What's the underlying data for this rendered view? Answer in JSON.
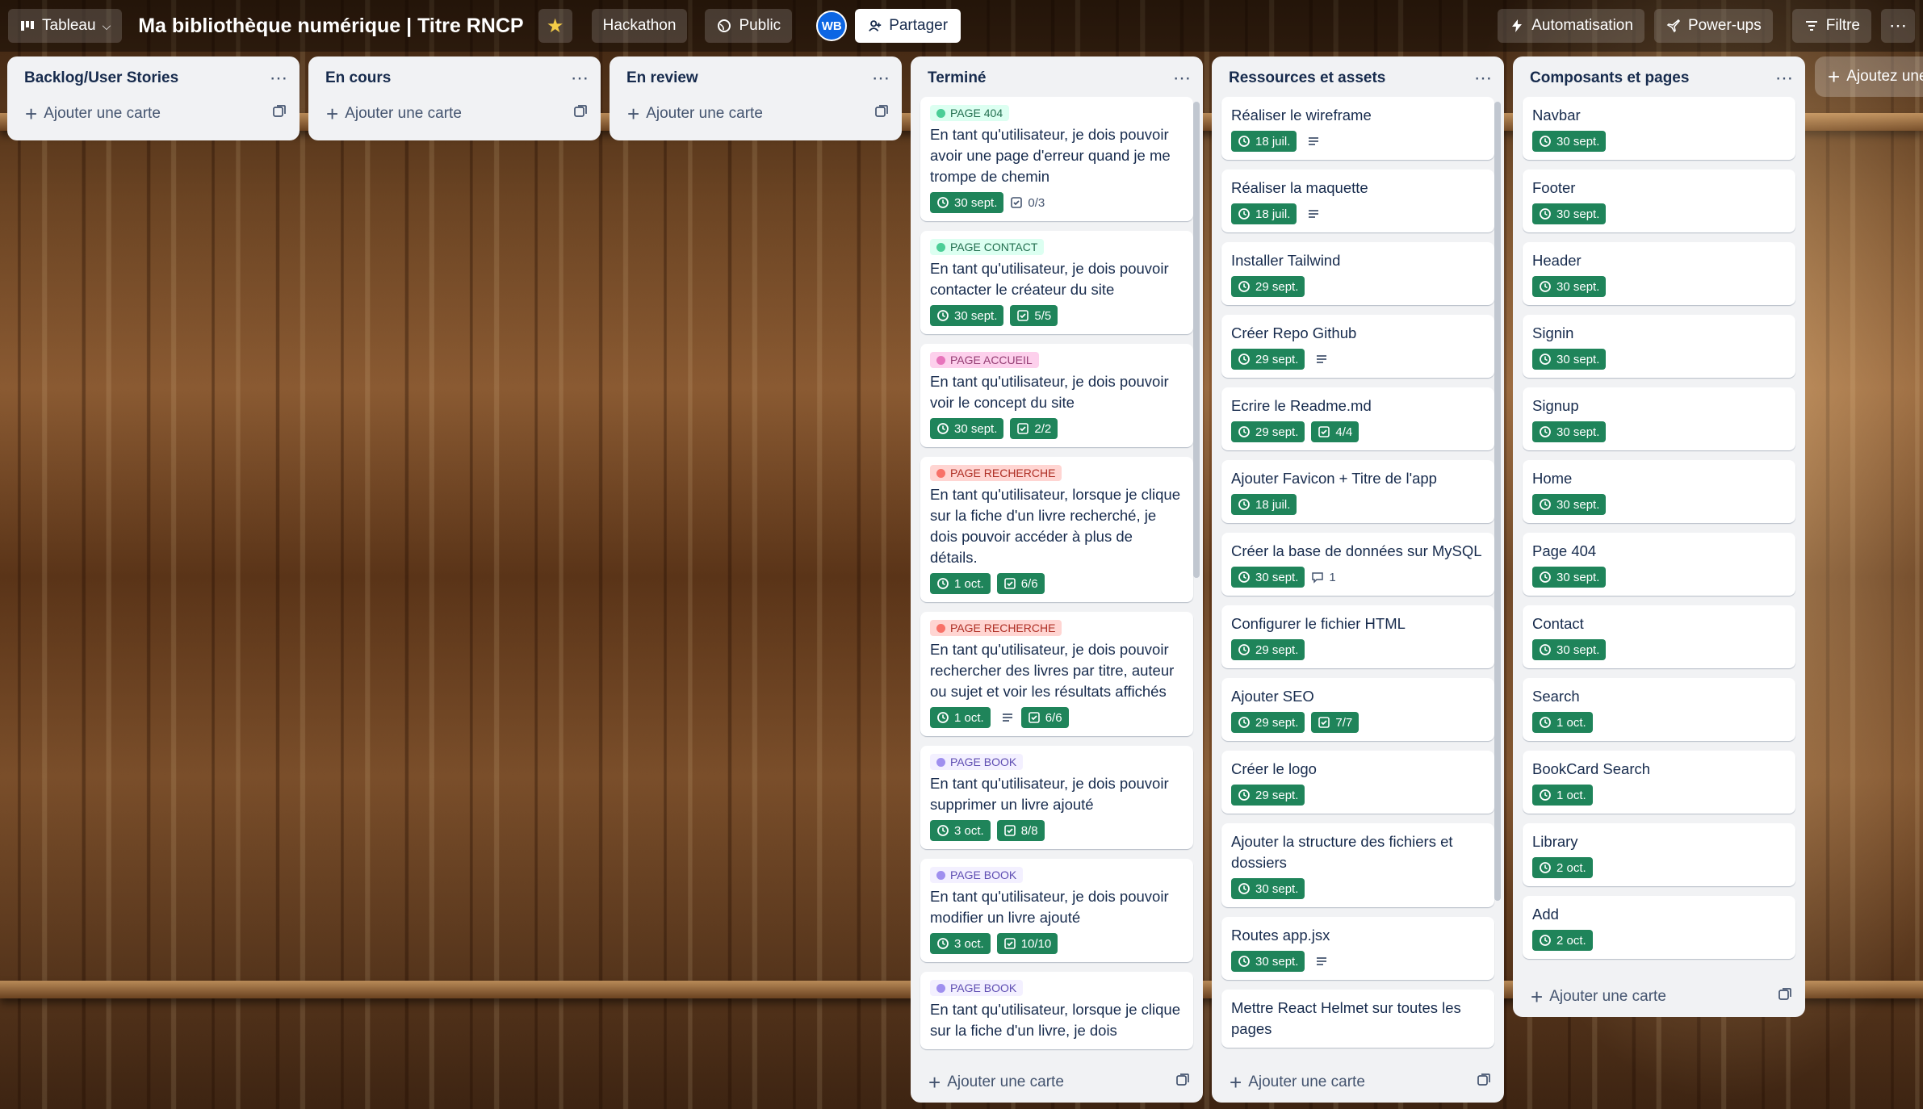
{
  "topbar": {
    "view_label": "Tableau",
    "board_title": "Ma bibliothèque numérique | Titre RNCP",
    "workspace": "Hackathon",
    "visibility": "Public",
    "avatar": "WB",
    "share": "Partager",
    "automation": "Automatisation",
    "powerups": "Power-ups",
    "filter": "Filtre"
  },
  "add_card": "Ajouter une carte",
  "add_list": "Ajoutez une liste",
  "colors": {
    "badge_green": "#1f845a",
    "label_green": "#dcfff1",
    "label_pink": "#fdd0ec",
    "label_red": "#ffd5d2",
    "label_purple": "#f3f0ff"
  },
  "lists": [
    {
      "title": "Backlog/User Stories",
      "cards": []
    },
    {
      "title": "En cours",
      "cards": []
    },
    {
      "title": "En review",
      "cards": []
    },
    {
      "title": "Terminé",
      "cards": [
        {
          "label": "PAGE 404",
          "label_color": "green",
          "title": "En tant qu'utilisateur, je dois pouvoir avoir une page d'erreur quand je me trompe de chemin",
          "due": "30 sept.",
          "checklist": "0/3",
          "checklist_done": false
        },
        {
          "label": "PAGE CONTACT",
          "label_color": "green",
          "title": "En tant qu'utilisateur, je dois pouvoir contacter le créateur du site",
          "due": "30 sept.",
          "checklist": "5/5",
          "checklist_done": true
        },
        {
          "label": "PAGE ACCUEIL",
          "label_color": "pink",
          "title": "En tant qu'utilisateur, je dois pouvoir voir le concept du site",
          "due": "30 sept.",
          "checklist": "2/2",
          "checklist_done": true
        },
        {
          "label": "PAGE RECHERCHE",
          "label_color": "red",
          "title": "En tant qu'utilisateur, lorsque je clique sur la fiche d'un livre recherché, je dois pouvoir accéder à plus de détails.",
          "due": "1 oct.",
          "checklist": "6/6",
          "checklist_done": true
        },
        {
          "label": "PAGE RECHERCHE",
          "label_color": "red",
          "title": "En tant qu'utilisateur, je dois pouvoir rechercher des livres par titre, auteur ou sujet et voir les résultats affichés",
          "due": "1 oct.",
          "description": true,
          "checklist": "6/6",
          "checklist_done": true
        },
        {
          "label": "PAGE BOOK",
          "label_color": "purple",
          "title": "En tant qu'utilisateur, je dois pouvoir supprimer un livre ajouté",
          "due": "3 oct.",
          "checklist": "8/8",
          "checklist_done": true
        },
        {
          "label": "PAGE BOOK",
          "label_color": "purple",
          "title": "En tant qu'utilisateur, je dois pouvoir modifier un livre ajouté",
          "due": "3 oct.",
          "checklist": "10/10",
          "checklist_done": true
        },
        {
          "label": "PAGE BOOK",
          "label_color": "purple",
          "title": "En tant qu'utilisateur, lorsque je clique sur la fiche d'un livre, je dois"
        }
      ]
    },
    {
      "title": "Ressources et assets",
      "cards": [
        {
          "title": "Réaliser le wireframe",
          "due": "18 juil.",
          "description": true
        },
        {
          "title": "Réaliser la maquette",
          "due": "18 juil.",
          "description": true
        },
        {
          "title": "Installer Tailwind",
          "due": "29 sept."
        },
        {
          "title": "Créer Repo Github",
          "due": "29 sept.",
          "description": true
        },
        {
          "title": "Ecrire le Readme.md",
          "due": "29 sept.",
          "checklist": "4/4",
          "checklist_done": true
        },
        {
          "title": "Ajouter Favicon + Titre de l'app",
          "due": "18 juil."
        },
        {
          "title": "Créer la base de données sur MySQL",
          "due": "30 sept.",
          "comments": "1"
        },
        {
          "title": "Configurer le fichier HTML",
          "due": "29 sept."
        },
        {
          "title": "Ajouter SEO",
          "due": "29 sept.",
          "checklist": "7/7",
          "checklist_done": true
        },
        {
          "title": "Créer le logo",
          "due": "29 sept."
        },
        {
          "title": "Ajouter la structure des fichiers et dossiers",
          "due": "30 sept."
        },
        {
          "title": "Routes app.jsx",
          "due": "30 sept.",
          "description": true
        },
        {
          "title": "Mettre React Helmet sur toutes les pages",
          "due": ""
        }
      ]
    },
    {
      "title": "Composants et pages",
      "cards": [
        {
          "title": "Navbar",
          "due": "30 sept."
        },
        {
          "title": "Footer",
          "due": "30 sept."
        },
        {
          "title": "Header",
          "due": "30 sept."
        },
        {
          "title": "Signin",
          "due": "30 sept."
        },
        {
          "title": "Signup",
          "due": "30 sept."
        },
        {
          "title": "Home",
          "due": "30 sept."
        },
        {
          "title": "Page 404",
          "due": "30 sept."
        },
        {
          "title": "Contact",
          "due": "30 sept."
        },
        {
          "title": "Search",
          "due": "1 oct."
        },
        {
          "title": "BookCard Search",
          "due": "1 oct."
        },
        {
          "title": "Library",
          "due": "2 oct."
        },
        {
          "title": "Add",
          "due": "2 oct."
        }
      ]
    }
  ]
}
